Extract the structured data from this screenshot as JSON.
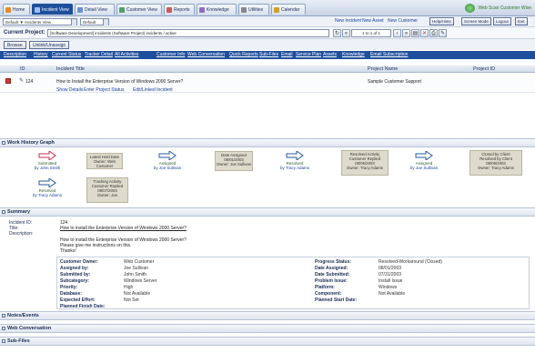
{
  "nav": {
    "tabs": [
      "Home",
      "Incident View",
      "Detail View",
      "Customer View",
      "Reports",
      "Knowledge",
      "Utilities",
      "Calendar"
    ],
    "brand": "Web Scan Customer Wise"
  },
  "toolbar": {
    "view_select": "Default ▼ Incidents View",
    "filter_select": "Default",
    "link_new_incident": "New Incident",
    "link_new_asset": "New Asset",
    "link_new_customer": "New Customer",
    "btn_help": "Help/Hints",
    "btn_screen_mode": "Screen Mode",
    "btn_logout": "Logout",
    "btn_exit": "Exit"
  },
  "current_project": {
    "label": "Current Project:",
    "value": "[Software Development] incidents (Software Project)   incidents / active",
    "pager": "1 to 1 of 1"
  },
  "actions": {
    "browse": "Browse",
    "unlink": "Unlink/Unassign"
  },
  "quick_links": [
    "Description",
    "History",
    "Current Status",
    "Tracker Detail",
    "All Activities",
    "Customer Info",
    "Web Conversation",
    "Quick Reports",
    "Sub-Files",
    "Email",
    "Service Plan",
    "Assets",
    "Knowledge",
    "Email Subscription"
  ],
  "grid": {
    "columns": [
      "ID",
      "Incident Title",
      "Project Name",
      "Project ID"
    ],
    "row": {
      "id": "124",
      "title": "How to Install the Enterprise Version of Windows 2000 Server?",
      "project": "Sample Customer Support",
      "project_id": ""
    },
    "row_links": [
      "Show Details",
      "Enter Project Status",
      "Edit/Linked Incident"
    ]
  },
  "sections": {
    "workflow": "Work History Graph",
    "summary": "Summary",
    "notes": "Notes/Events",
    "webconv": "Web Conversation",
    "subfiles": "Sub-Files"
  },
  "workflow": {
    "nodes": [
      {
        "label": "Submitted",
        "sub": "by John Smith"
      },
      {
        "label": "Assigned",
        "sub": "by Joe Sullivan"
      },
      {
        "label": "Assigned",
        "sub": "by Joe Sullivan"
      },
      {
        "label": "Resolved",
        "sub": "by Tracy Adams"
      },
      {
        "label": "Assigned",
        "sub": "by Joe Sullivan"
      },
      {
        "label": "Resolved",
        "sub": "by Tracy Adams"
      }
    ],
    "boxes": [
      [
        "Latest Hold Date",
        "Owner: Web Customer"
      ],
      [
        "Date Assigned",
        "08/01/2003",
        "Owner: Joe Sullivan"
      ],
      [
        "Resolved Activity",
        "Customer Replied",
        "08/05/2003",
        "Owner: Tracy Adams"
      ],
      [
        "Closed by Client",
        "Resolved by Client",
        "08/06/2003",
        "Owner: Tracy Adams"
      ],
      [
        "Tracking Activity",
        "Customer Replied",
        "08/07/2003",
        "Owner: Joe"
      ]
    ]
  },
  "summary": {
    "id_label": "Incident ID:",
    "id": "124",
    "title_label": "Title:",
    "title": "How to install the Enterprise Version of Windows 2000 Server?",
    "desc_label": "Description:",
    "desc_lines": [
      "How to install the Enterprise Version of Windows 2000 Server?",
      "Please give me instructions on this.",
      "Thanks!"
    ],
    "fields": [
      [
        "Customer Owner:",
        "Web Customer",
        "Progress Status:",
        "Resolved-Workaround (Closed)"
      ],
      [
        "Assigned by:",
        "Joe Sullivan",
        "Date Assigned:",
        "08/01/2003"
      ],
      [
        "Submitted by:",
        "John Smith",
        "Date Submitted:",
        "07/31/2003"
      ],
      [
        "Subcategory:",
        "Windows Server",
        "Problem Issue:",
        "Install Issue"
      ],
      [
        "Priority:",
        "High",
        "Platform:",
        "Windows"
      ],
      [
        "Database:",
        "Not Available",
        "Component:",
        "Not Available"
      ],
      [
        "Expected Effort:",
        "Not Set",
        "Planned Start Date:",
        ""
      ],
      [
        "Planned Finish Date:",
        "",
        "",
        ""
      ]
    ]
  },
  "colors": {
    "nav_active": "#1f4f9c",
    "workflow_box": "#dedbcc",
    "icon_red": "#d33b2c"
  }
}
